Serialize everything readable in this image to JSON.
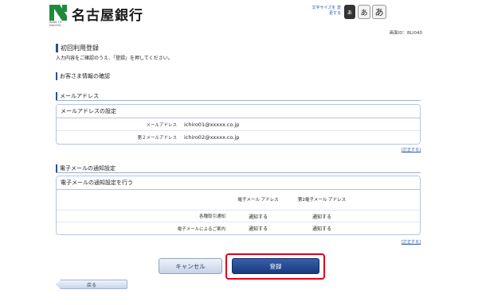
{
  "header": {
    "bank_name": "名古屋銀行",
    "logo_sub": "BANK OF NAGOYA",
    "font_size_label": "文字サイズを 変更する",
    "font_small": "あ",
    "font_medium": "あ",
    "font_large": "あ"
  },
  "screen_id": "画面ID：BLI040",
  "page": {
    "title": "初回利用登録",
    "description": "入力内容をご確認のうえ、「登録」を押してください。"
  },
  "customer_section": {
    "heading": "お客さま情報の確認"
  },
  "mail_section": {
    "heading": "メールアドレス",
    "panel_title": "メールアドレスの設定",
    "rows": [
      {
        "label": "メールアドレス",
        "value": "ichiro01@xxxxx.co.jp"
      },
      {
        "label": "第２メールアドレス",
        "value": "ichiro02@xxxxx.co.jp"
      }
    ],
    "edit_link": "[訂正する]"
  },
  "notify_section": {
    "heading": "電子メールの通知設定",
    "panel_title": "電子メールの通知設定を行う",
    "col1_header": "電子メール アドレス",
    "col2_header": "第2電子メール アドレス",
    "rows": [
      {
        "label": "各種取引通知",
        "col1": "通知する",
        "col2": "通知する"
      },
      {
        "label": "電子メールによるご案内",
        "col1": "通知する",
        "col2": "通知する"
      }
    ],
    "edit_link": "[訂正する]"
  },
  "buttons": {
    "cancel": "キャンセル",
    "register": "登録",
    "back": "戻る"
  },
  "colors": {
    "accent": "#2d4f8e",
    "logo_green": "#1f8a3a",
    "highlight_red": "#e2001a"
  }
}
